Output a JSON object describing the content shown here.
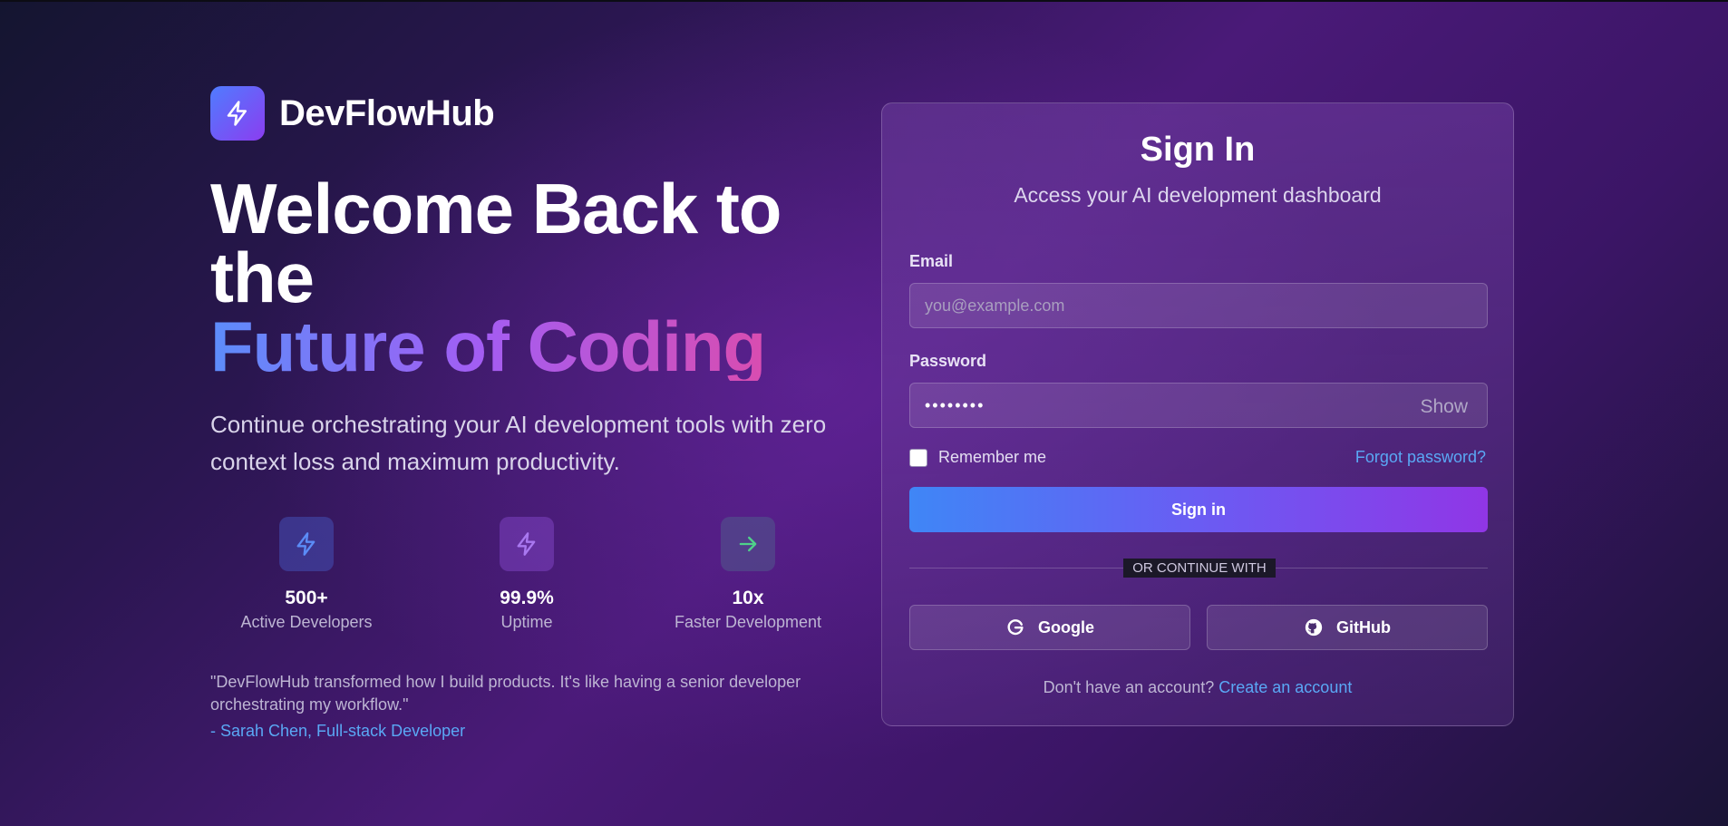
{
  "brand": {
    "name": "DevFlowHub",
    "logo_icon": "lightning-icon"
  },
  "hero": {
    "line1": "Welcome Back to",
    "line2": "the",
    "line3": "Future of Coding",
    "subtext": "Continue orchestrating your AI development tools with zero context loss and maximum productivity."
  },
  "stats": [
    {
      "value": "500+",
      "label": "Active Developers",
      "icon": "lightning-icon",
      "color": "#5b8cf7"
    },
    {
      "value": "99.9%",
      "label": "Uptime",
      "icon": "lightning-icon",
      "color": "#a978f0"
    },
    {
      "value": "10x",
      "label": "Faster Development",
      "icon": "arrow-right-icon",
      "color": "#4fd08a"
    }
  ],
  "testimonial": {
    "quote": "\"DevFlowHub transformed how I build products. It's like having a senior developer orchestrating my workflow.\"",
    "author": "- Sarah Chen, Full-stack Developer"
  },
  "signin": {
    "title": "Sign In",
    "subtitle": "Access your AI development dashboard",
    "email_label": "Email",
    "email_placeholder": "you@example.com",
    "password_label": "Password",
    "password_value": "••••••••",
    "show_label": "Show",
    "remember_label": "Remember me",
    "forgot_label": "Forgot password?",
    "submit_label": "Sign in",
    "divider_text": "OR CONTINUE WITH",
    "google_label": "Google",
    "github_label": "GitHub",
    "no_account_text": "Don't have an account?",
    "create_account_label": "Create an account"
  },
  "colors": {
    "accent_blue": "#3f86f6",
    "accent_purple": "#9036e6",
    "link": "#5aa8f5"
  }
}
